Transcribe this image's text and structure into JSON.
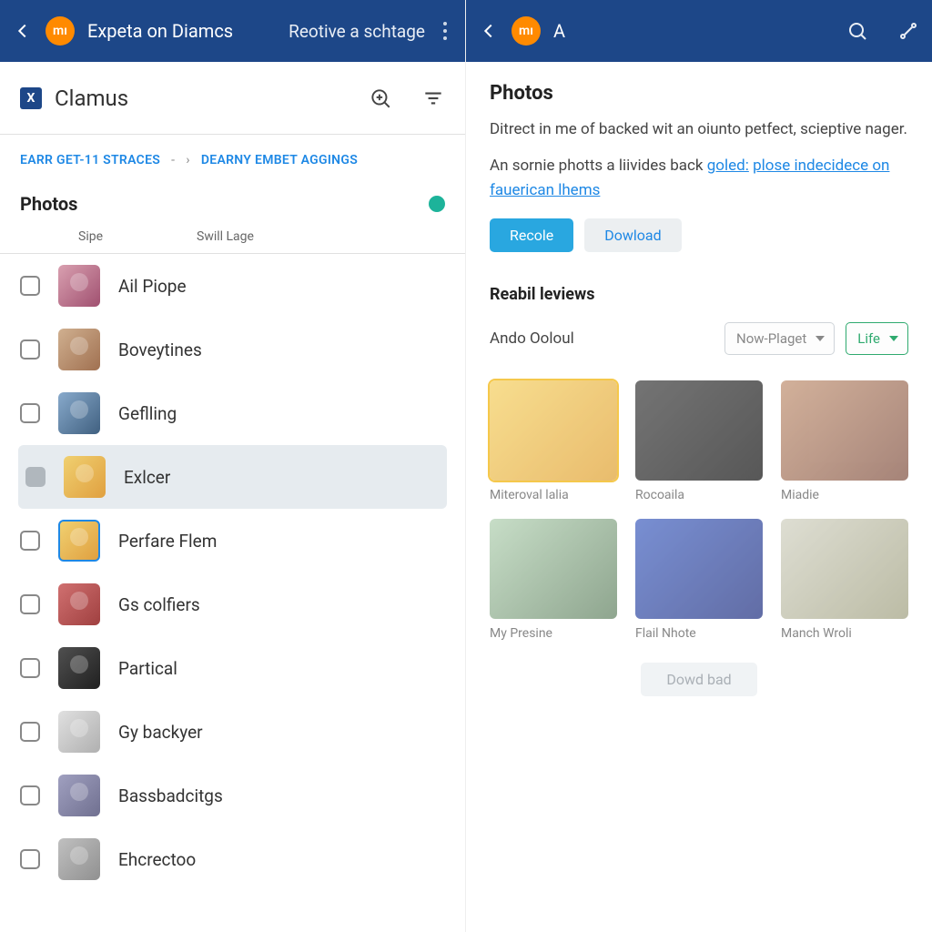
{
  "left": {
    "appbar": {
      "title": "Expeta on Diamcs",
      "action": "Reotive a schtage"
    },
    "subbar": {
      "title": "Clamus"
    },
    "breadcrumbs": {
      "first": "EARR GET-11 STRACES",
      "second": "DEARNY EMBET AGGINGS"
    },
    "section": "Photos",
    "columns": {
      "c1": "Sipe",
      "c2": "Swill Lage"
    },
    "rows": [
      {
        "label": "Ail Piope"
      },
      {
        "label": "Boveytines"
      },
      {
        "label": "Geflling"
      },
      {
        "label": "Exlcer",
        "selected": true
      },
      {
        "label": "Perfare Flem",
        "outlined": true
      },
      {
        "label": "Gs colfiers"
      },
      {
        "label": "Partical"
      },
      {
        "label": "Gy backyer"
      },
      {
        "label": "Bassbadcitgs"
      },
      {
        "label": "Ehcrectoo"
      }
    ]
  },
  "right": {
    "appbar": {
      "title": "A"
    },
    "title": "Photos",
    "desc_plain": "Ditrect in me of backed wit an oiunto petfect, scieptive nager.",
    "desc2_prefix": "An sornie photts a liivides back ",
    "desc2_link1": "goled:",
    "desc2_mid": " ",
    "desc2_link2": "plose indecidece on fauerican lhems",
    "btn_primary": "Recole",
    "btn_secondary": "Dowload",
    "subtitle": "Reabil leviews",
    "user": "Ando Ooloul",
    "select1": "Now-Plaget",
    "select2": "Life",
    "cards": [
      {
        "label": "Miteroval lalia",
        "sel": true
      },
      {
        "label": "Rocoaila"
      },
      {
        "label": "Miadie"
      },
      {
        "label": "My Presine"
      },
      {
        "label": "Flail Nhote"
      },
      {
        "label": "Manch Wroli"
      }
    ],
    "btn_download": "Dowd bad"
  }
}
